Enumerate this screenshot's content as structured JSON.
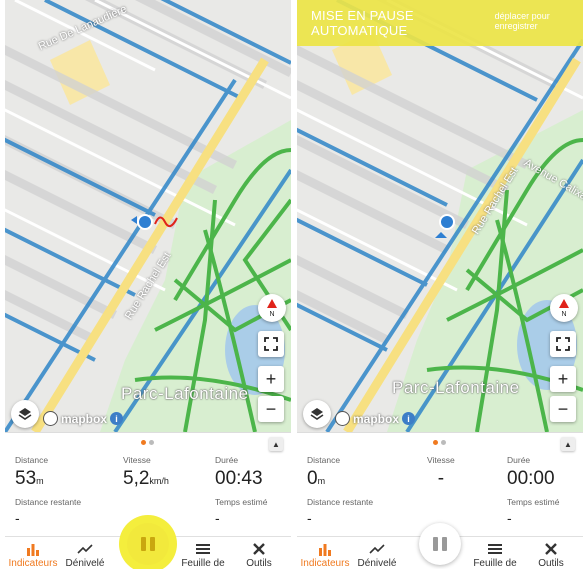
{
  "colors": {
    "accent_orange": "#f07a20",
    "banner_yellow": "#ece446",
    "fab_glow": "#f4ee3d",
    "route_red": "#e0231a"
  },
  "map": {
    "park_label": "Parc-Lafontaine",
    "streets": [
      "Rue De Lanaudière",
      "Rue Rachel Est",
      "Avenue Calixa-Lavallée"
    ],
    "attribution": "mapbox",
    "compass_letter": "N",
    "zoom_in": "+",
    "zoom_out": "−"
  },
  "screens": [
    {
      "id": "left",
      "auto_pause_banner": null,
      "stats": {
        "distance": {
          "label": "Distance",
          "value": "53",
          "unit": "m"
        },
        "speed": {
          "label": "Vitesse",
          "value": "5,2",
          "unit": "km/h"
        },
        "duration": {
          "label": "Durée",
          "value": "00:43"
        },
        "remaining": {
          "label": "Distance restante",
          "value": "-"
        },
        "estimated": {
          "label": "Temps estimé",
          "value": "-"
        }
      },
      "fab_state": "highlighted"
    },
    {
      "id": "right",
      "auto_pause_banner": {
        "main": "MISE EN PAUSE AUTOMATIQUE",
        "sub": "déplacer pour enregistrer"
      },
      "stats": {
        "distance": {
          "label": "Distance",
          "value": "0",
          "unit": "m"
        },
        "speed": {
          "label": "Vitesse",
          "value": "-"
        },
        "duration": {
          "label": "Durée",
          "value": "00:00"
        },
        "remaining": {
          "label": "Distance restante",
          "value": "-"
        },
        "estimated": {
          "label": "Temps estimé",
          "value": "-"
        }
      },
      "fab_state": "grey"
    }
  ],
  "nav": {
    "items": [
      {
        "label": "Indicateurs",
        "icon": "bar-chart-icon",
        "active": true
      },
      {
        "label": "Dénivelé",
        "icon": "elevation-icon",
        "active": false
      },
      {
        "label": "Feuille de",
        "icon": "list-icon",
        "active": false
      },
      {
        "label": "Outils",
        "icon": "tools-icon",
        "active": false
      }
    ]
  }
}
